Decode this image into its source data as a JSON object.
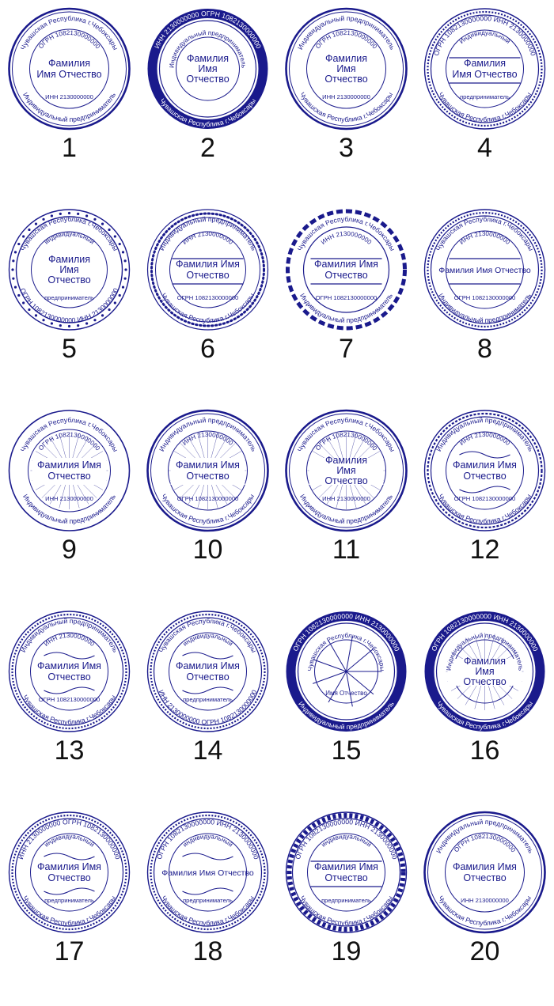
{
  "colors": {
    "ink": "#1a1a8c",
    "number": "#111111",
    "background": "#ffffff"
  },
  "stamps": [
    {
      "number": "1",
      "outer": "Чувашская Республика г.Чебоксары",
      "outer2": "Индивидуальный предприниматель",
      "mid": "ОГРН 1082130000000",
      "center": [
        "Фамилия",
        "Имя Отчество"
      ],
      "bottom": "ИНН 2130000000",
      "border": "double",
      "deco": "none"
    },
    {
      "number": "2",
      "outer": "ИНН 2130000000  ОГРН 1082130000000",
      "mid": "Индивидуальный предприниматель",
      "center": [
        "Фамилия",
        "Имя",
        "Отчество"
      ],
      "bottom": "Чувашская Республика г.Чебоксары",
      "border": "band",
      "deco": "none"
    },
    {
      "number": "3",
      "outer": "Индивидуальный предприниматель",
      "mid": "ОГРН 1082130000000",
      "center": [
        "Фамилия",
        "Имя",
        "Отчество"
      ],
      "bottom": "ИНН 2130000000",
      "outer2": "Чувашская Республика г.Чебоксары",
      "border": "double",
      "deco": "none"
    },
    {
      "number": "4",
      "outer": "ОГРН 1082130000000  ИНН 2130000000",
      "mid": "Индивидуальный",
      "center": [
        "Фамилия",
        "Имя Отчество"
      ],
      "bottom": "предприниматель",
      "outer2": "Чувашская Республика г.Чебоксары",
      "border": "rope",
      "deco": "bars"
    },
    {
      "number": "5",
      "outer": "Чувашская Республика г.Чебоксары",
      "mid": "индивидуальный",
      "center": [
        "Фамилия",
        "Имя",
        "Отчество"
      ],
      "bottom": "предприниматель",
      "outer2": "ОГРН 1082130000000   ИНН 2130000000",
      "border": "stars",
      "deco": "none"
    },
    {
      "number": "6",
      "outer": "Индивидуальный предприниматель",
      "mid": "ИНН 2130000000",
      "center": [
        "Фамилия Имя",
        "Отчество"
      ],
      "bottom": "ОГРН 1082130000000",
      "outer2": "Чувашская Республика г.Чебоксары",
      "border": "dots",
      "deco": "arcs"
    },
    {
      "number": "7",
      "outer": "Чувашская Республика г.Чебоксары",
      "mid": "ИНН 2130000000",
      "center": [
        "Фамилия Имя",
        "Отчество"
      ],
      "bottom": "ОГРН 1082130000000",
      "outer2": "Индивидуальный предприниматель",
      "border": "dashed",
      "deco": "lines"
    },
    {
      "number": "8",
      "outer": "Чувашская Республика г.Чебоксары",
      "mid": "ИНН 2130000000",
      "center": [
        "Фамилия Имя Отчество"
      ],
      "bottom": "ОГРН 1082130000000",
      "outer2": "Индивидуальный предприниматель",
      "border": "meander",
      "deco": "arcs"
    },
    {
      "number": "9",
      "outer": "Чувашская Республика г.Чебоксары",
      "mid": "ОГРН 1082130000000",
      "center": [
        "Фамилия Имя",
        "Отчество"
      ],
      "bottom": "ИНН 2130000000",
      "outer2": "Индивидуальный предприниматель",
      "border": "single",
      "deco": "fan"
    },
    {
      "number": "10",
      "outer": "Индивидуальный предприниматель",
      "mid": "ИНН 2130000000",
      "center": [
        "Фамилия Имя",
        "Отчество"
      ],
      "bottom": "ОГРН 1082130000000",
      "outer2": "Чувашская Республика г.Чебоксары",
      "border": "double",
      "deco": "rosette"
    },
    {
      "number": "11",
      "outer": "Чувашская Республика г.Чебоксары",
      "mid": "ОГРН 1082130000000",
      "center": [
        "Фамилия",
        "Имя",
        "Отчество"
      ],
      "bottom": "ИНН 2130000000",
      "outer2": "Индивидуальный предприниматель",
      "border": "double",
      "deco": "wave"
    },
    {
      "number": "12",
      "outer": "Индивидуальный предприниматель",
      "mid": "ИНН 2130000000",
      "center": [
        "Фамилия Имя",
        "Отчество"
      ],
      "bottom": "ОГРН 1082130000000",
      "outer2": "Чувашская Республика г.Чебоксары",
      "border": "scallop",
      "deco": "flourish"
    },
    {
      "number": "13",
      "outer": "Индивидуальный предприниматель",
      "mid": "ИНН 2130000000",
      "center": [
        "Фамилия Имя",
        "Отчество"
      ],
      "bottom": "ОГРН 1082130000000",
      "outer2": "Чувашская Республика г.Чебоксары",
      "border": "rope",
      "deco": "flourish"
    },
    {
      "number": "14",
      "outer": "Чувашская Республика г.Чебоксары",
      "mid": "индивидуальный",
      "center": [
        "Фамилия Имя",
        "Отчество"
      ],
      "bottom": "предприниматель",
      "outer2": "ИНН 2130000000   ОГРН 1082130000000",
      "border": "rope",
      "deco": "scroll"
    },
    {
      "number": "15",
      "outer": "ОГРН 1082130000000   ИНН 2130000000",
      "mid": "Чувашская Республика г.Чебоксары",
      "center": [],
      "bottom": "Индивидуальный предприниматель",
      "bottom2": "Имя Отчество",
      "border": "band",
      "deco": "star"
    },
    {
      "number": "16",
      "outer": "ОГРН 1082130000000   ИНН 2130000000",
      "mid": "Индивидуальный предприниматель",
      "center": [
        "Фамилия",
        "Имя",
        "Отчество"
      ],
      "bottom": "Чувашская Республика г.Чебоксары",
      "border": "band",
      "deco": "floral"
    },
    {
      "number": "17",
      "outer": "ИНН 2130000000   ОГРН 1082130000000",
      "mid": "индивидуальный",
      "center": [
        "Фамилия Имя",
        "Отчество"
      ],
      "bottom": "предприниматель",
      "outer2": "Чувашская Республика г.Чебоксары",
      "border": "rope",
      "deco": "birds"
    },
    {
      "number": "18",
      "outer": "ОГРН 1082130000000   ИНН 2130000000",
      "mid": "индивидуальный",
      "center": [
        "Фамилия Имя Отчество"
      ],
      "bottom": "предприниматель",
      "outer2": "Чувашская Республика г.Чебоксары",
      "border": "fine",
      "deco": "flourish"
    },
    {
      "number": "19",
      "outer": "ОГРН 1082130000000   ИНН 2130000000",
      "mid": "индивидуальный",
      "center": [
        "Фамилия Имя",
        "Отчество"
      ],
      "bottom": "предприниматель",
      "outer2": "Чувашская Республика г.Чебоксары",
      "border": "ticks",
      "deco": "lines"
    },
    {
      "number": "20",
      "outer": "Индивидуальный предприниматель",
      "mid": "ОГРН 1082130000000",
      "center": [
        "Фамилия Имя",
        "Отчество"
      ],
      "bottom": "ИНН 2130000000",
      "outer2": "Чувашская Республика г.Чебоксары",
      "border": "double",
      "deco": "none"
    }
  ]
}
